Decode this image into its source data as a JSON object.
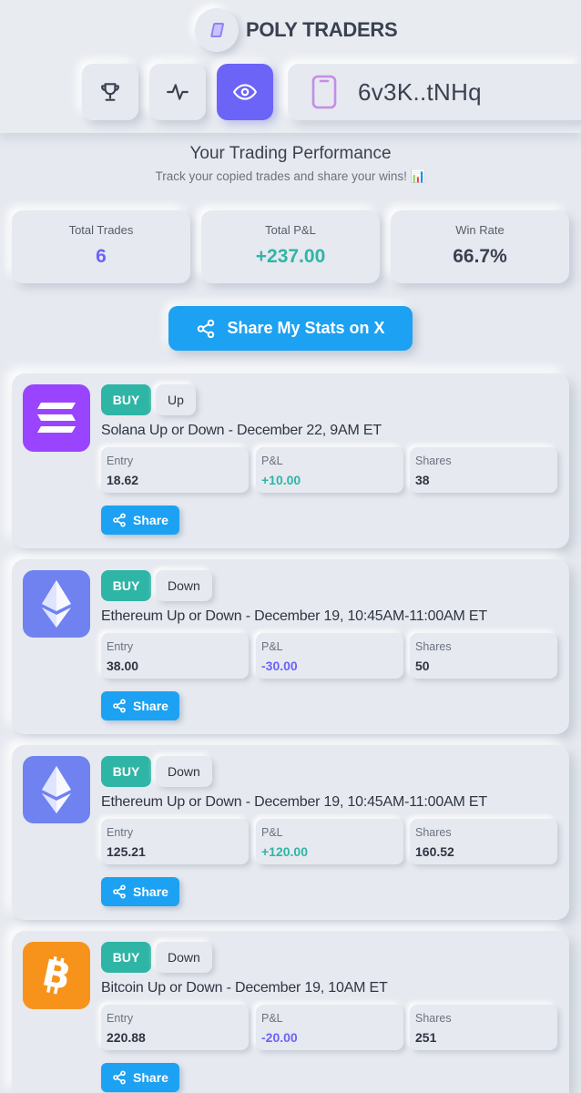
{
  "brand": {
    "name": "POLY TRADERS",
    "icon": "book-icon",
    "color": "#7b6cf6"
  },
  "nav": [
    {
      "icon": "trophy-icon",
      "active": false
    },
    {
      "icon": "activity-icon",
      "active": false
    },
    {
      "icon": "eye-icon",
      "active": true
    }
  ],
  "wallet": {
    "icon": "phone-wallet-icon",
    "address": "6v3K..tNHq"
  },
  "performance": {
    "title": "Your Trading Performance",
    "subtitle": "Track your copied trades and share your wins! 📊"
  },
  "stats": [
    {
      "label": "Total Trades",
      "value": "6",
      "color": "#6c63f7"
    },
    {
      "label": "Total P&L",
      "value": "+237.00",
      "color": "#2fb5a5"
    },
    {
      "label": "Win Rate",
      "value": "66.7%",
      "color": "#3a4150"
    }
  ],
  "share_main": {
    "label": "Share My Stats on X",
    "icon": "share-icon"
  },
  "metric_labels": {
    "entry": "Entry",
    "pnl": "P&L",
    "shares": "Shares"
  },
  "trade_share_label": "Share",
  "trades": [
    {
      "coin": "solana",
      "coin_icon": "solana-icon",
      "coin_color": "#9945ff",
      "side": "BUY",
      "direction": "Up",
      "market": "Solana Up or Down - December 22, 9AM ET",
      "entry": "18.62",
      "pnl": "+10.00",
      "shares": "38"
    },
    {
      "coin": "ethereum",
      "coin_icon": "ethereum-icon",
      "coin_color": "#6f82f0",
      "side": "BUY",
      "direction": "Down",
      "market": "Ethereum Up or Down - December 19, 10:45AM-11:00AM ET",
      "entry": "38.00",
      "pnl": "-30.00",
      "shares": "50"
    },
    {
      "coin": "ethereum",
      "coin_icon": "ethereum-icon",
      "coin_color": "#6f82f0",
      "side": "BUY",
      "direction": "Down",
      "market": "Ethereum Up or Down - December 19, 10:45AM-11:00AM ET",
      "entry": "125.21",
      "pnl": "+120.00",
      "shares": "160.52"
    },
    {
      "coin": "bitcoin",
      "coin_icon": "bitcoin-icon",
      "coin_color": "#f7931a",
      "side": "BUY",
      "direction": "Down",
      "market": "Bitcoin Up or Down - December 19, 10AM ET",
      "entry": "220.88",
      "pnl": "-20.00",
      "shares": "251"
    }
  ]
}
